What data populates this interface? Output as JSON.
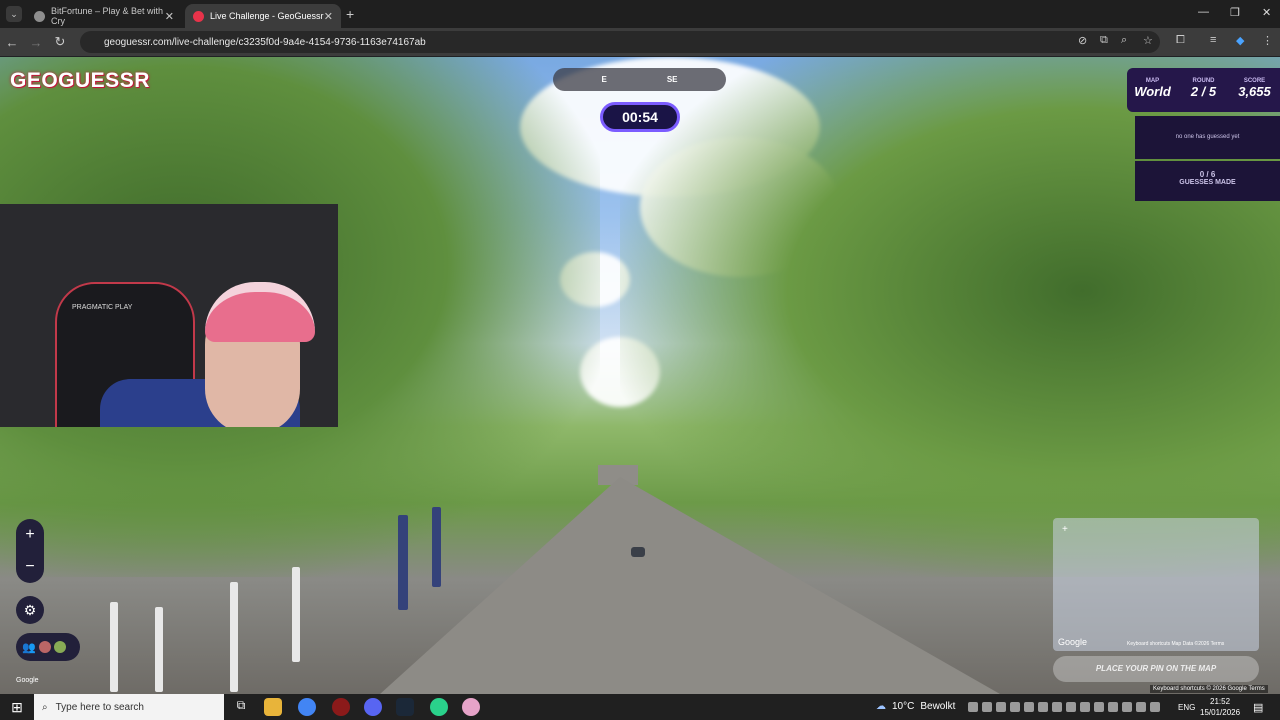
{
  "browser": {
    "tabs": [
      {
        "title": "BitFortune – Play & Bet with Cry",
        "favicon_color": "#8e8e8e"
      },
      {
        "title": "Live Challenge - GeoGuessr",
        "favicon_color": "#e8334a"
      }
    ],
    "url": "geoguessr.com/live-challenge/c3235f0d-9a4e-4154-9736-1163e74167ab"
  },
  "game": {
    "logo": "GEOGUESSR",
    "compass": {
      "left": "E",
      "right": "SE"
    },
    "timer": "00:54",
    "stats": [
      {
        "label": "MAP",
        "value": "World"
      },
      {
        "label": "ROUND",
        "value": "2 / 5"
      },
      {
        "label": "SCORE",
        "value": "3,655"
      }
    ],
    "guess_status": "no one has guessed yet",
    "guesses_count": "0 / 6",
    "guesses_label": "GUESSES MADE",
    "place_pin": "PLACE YOUR PIN ON THE MAP",
    "google_label": "Google",
    "map_footer": "Keyboard shortcuts   Map Data ©2026   Terms",
    "attribution": "Keyboard shortcuts  © 2026 Google  Terms",
    "webcam_chair_text": "PRAGMATIC PLAY"
  },
  "taskbar": {
    "search_placeholder": "Type here to search",
    "weather": {
      "temp": "10°C",
      "condition": "Bewolkt"
    },
    "language": "ENG",
    "time": "21:52",
    "date": "15/01/2026"
  }
}
